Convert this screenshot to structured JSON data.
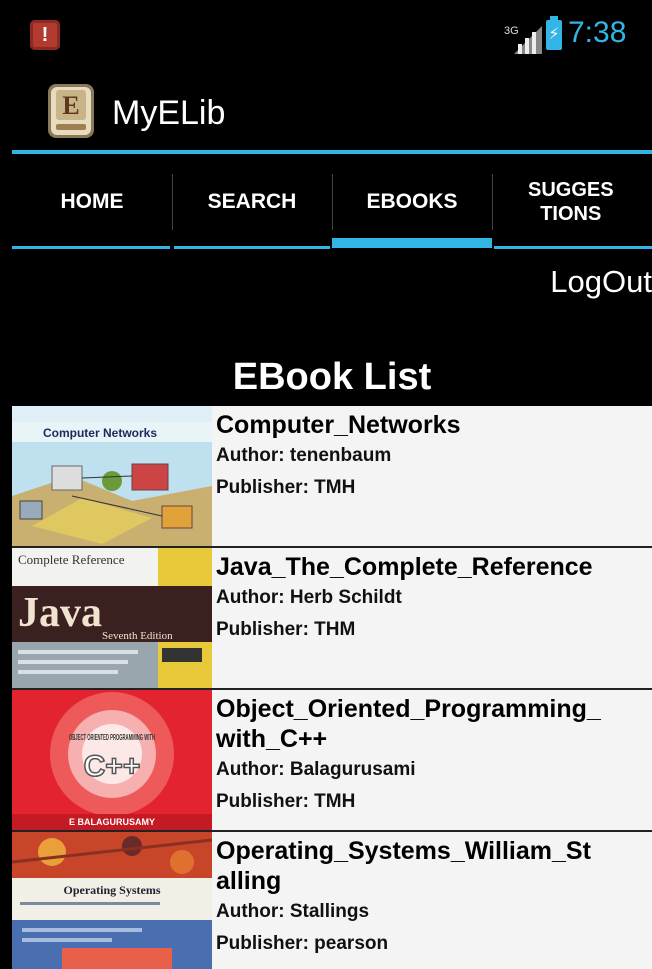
{
  "status_bar": {
    "notification_icon": "alert-icon",
    "network": "3G",
    "time": "7:38",
    "accent_color": "#33b5e5"
  },
  "app": {
    "title": "MyELib",
    "icon": "ebook-app-icon"
  },
  "tabs": [
    {
      "label": "HOME"
    },
    {
      "label": "SEARCH"
    },
    {
      "label": "EBOOKS"
    },
    {
      "label": "SUGGES\nTIONS"
    }
  ],
  "selected_tab": "EBOOKS",
  "logout_label": "LogOut",
  "list_title": "EBook List",
  "books": [
    {
      "name": "Computer_Networks",
      "author": "Author: tenenbaum",
      "publisher": "Publisher: TMH",
      "cover_title": "Computer Networks"
    },
    {
      "name": "Java_The_Complete_Reference",
      "author": "Author: Herb Schildt",
      "publisher": "Publisher: THM",
      "cover_title": "Java",
      "cover_subtitle": "Complete Reference",
      "cover_edition": "Seventh Edition"
    },
    {
      "name": "Object_Oriented_Programming_\nwith_C++",
      "author": "Author: Balagurusami",
      "publisher": "Publisher: TMH",
      "cover_title": "C++",
      "cover_subtitle": "OBJECT ORIENTED PROGRAMMING WITH",
      "cover_author": "E BALAGURUSAMY"
    },
    {
      "name": "Operating_Systems_William_St\nalling",
      "author": "Author: Stallings",
      "publisher": "Publisher: pearson",
      "cover_title": "Operating Systems"
    }
  ]
}
